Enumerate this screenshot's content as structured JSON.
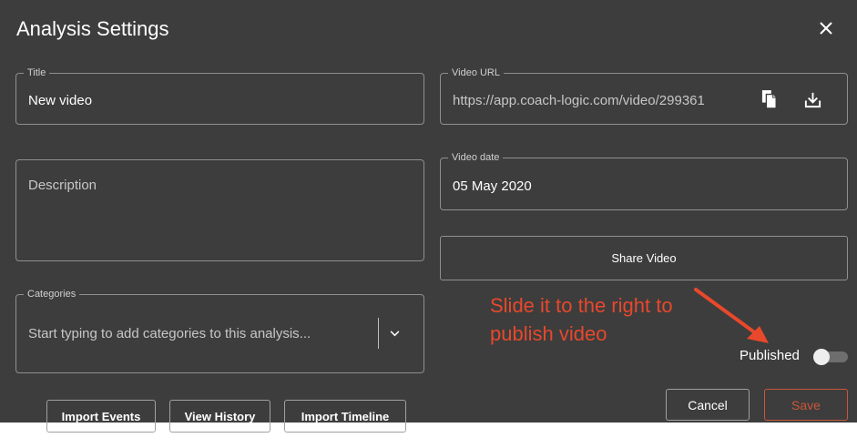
{
  "dialog": {
    "title": "Analysis Settings"
  },
  "icons": {
    "close": "close-icon",
    "copy": "copy-icon",
    "download": "download-icon",
    "chevron": "chevron-down-icon"
  },
  "fields": {
    "title": {
      "label": "Title",
      "value": "New video"
    },
    "video_url": {
      "label": "Video URL",
      "value": "https://app.coach-logic.com/video/299361"
    },
    "description": {
      "placeholder": "Description"
    },
    "video_date": {
      "label": "Video date",
      "value": "05 May 2020"
    },
    "categories": {
      "label": "Categories",
      "placeholder": "Start typing to add categories to this analysis..."
    }
  },
  "buttons": {
    "share": "Share Video",
    "import_events": "Import Events",
    "view_history": "View History",
    "import_timeline": "Import Timeline",
    "cancel": "Cancel",
    "save": "Save"
  },
  "annotation": {
    "text": "Slide it to the right to publish video",
    "color": "#e8482b"
  },
  "published": {
    "label": "Published",
    "on": false
  },
  "colors": {
    "background": "#3d3d3d",
    "border": "#8f8f8f",
    "save": "#c9573a"
  }
}
